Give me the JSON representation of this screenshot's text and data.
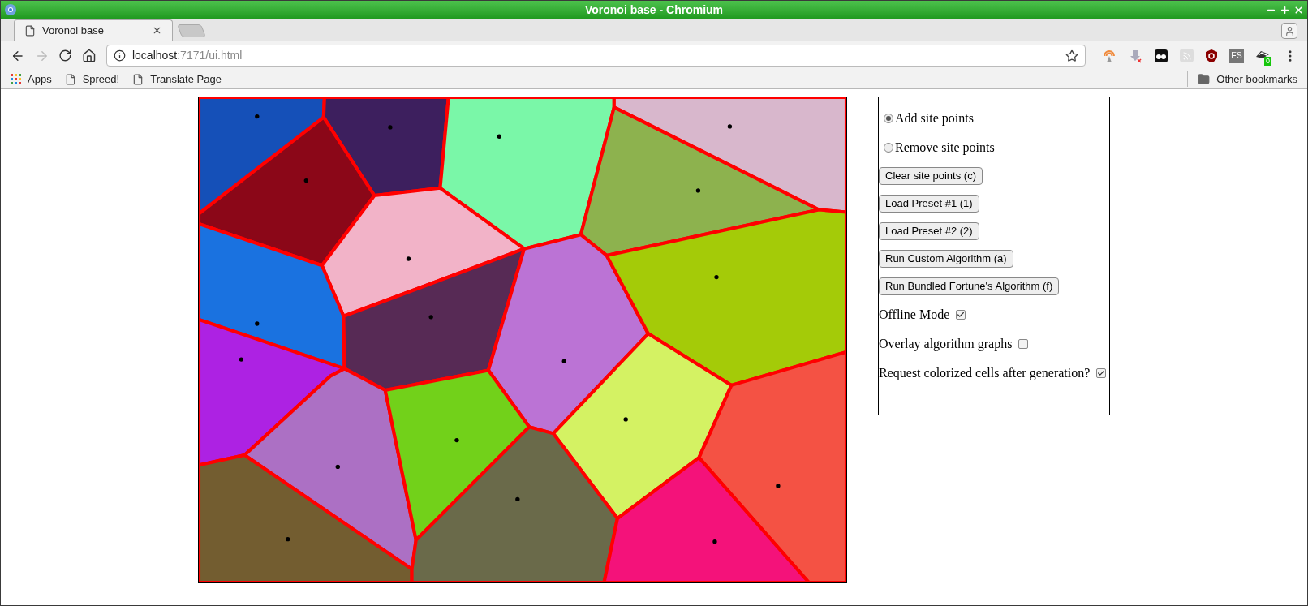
{
  "window": {
    "title": "Voronoi base - Chromium"
  },
  "tabs": [
    {
      "label": "Voronoi base",
      "selected": true
    }
  ],
  "address_bar": {
    "host": "localhost",
    "path": ":7171/ui.html"
  },
  "extensions": {
    "es_label": "ES",
    "badge": "0"
  },
  "bookmarks": [
    {
      "label": "Apps",
      "kind": "apps"
    },
    {
      "label": "Spreed!",
      "kind": "page"
    },
    {
      "label": "Translate Page",
      "kind": "page"
    }
  ],
  "other_bookmarks": "Other bookmarks",
  "panel": {
    "modes": [
      {
        "label": "Add site points",
        "selected": true
      },
      {
        "label": "Remove site points",
        "selected": false
      }
    ],
    "buttons": [
      "Clear site points (c)",
      "Load Preset #1 (1)",
      "Load Preset #2 (2)",
      "Run Custom Algorithm (a)",
      "Run Bundled Fortune's Algorithm (f)"
    ],
    "options": [
      {
        "label": "Offline Mode",
        "checked": true
      },
      {
        "label": "Overlay algorithm graphs",
        "checked": false
      },
      {
        "label": "Request colorized cells after generation?",
        "checked": true
      }
    ]
  }
}
